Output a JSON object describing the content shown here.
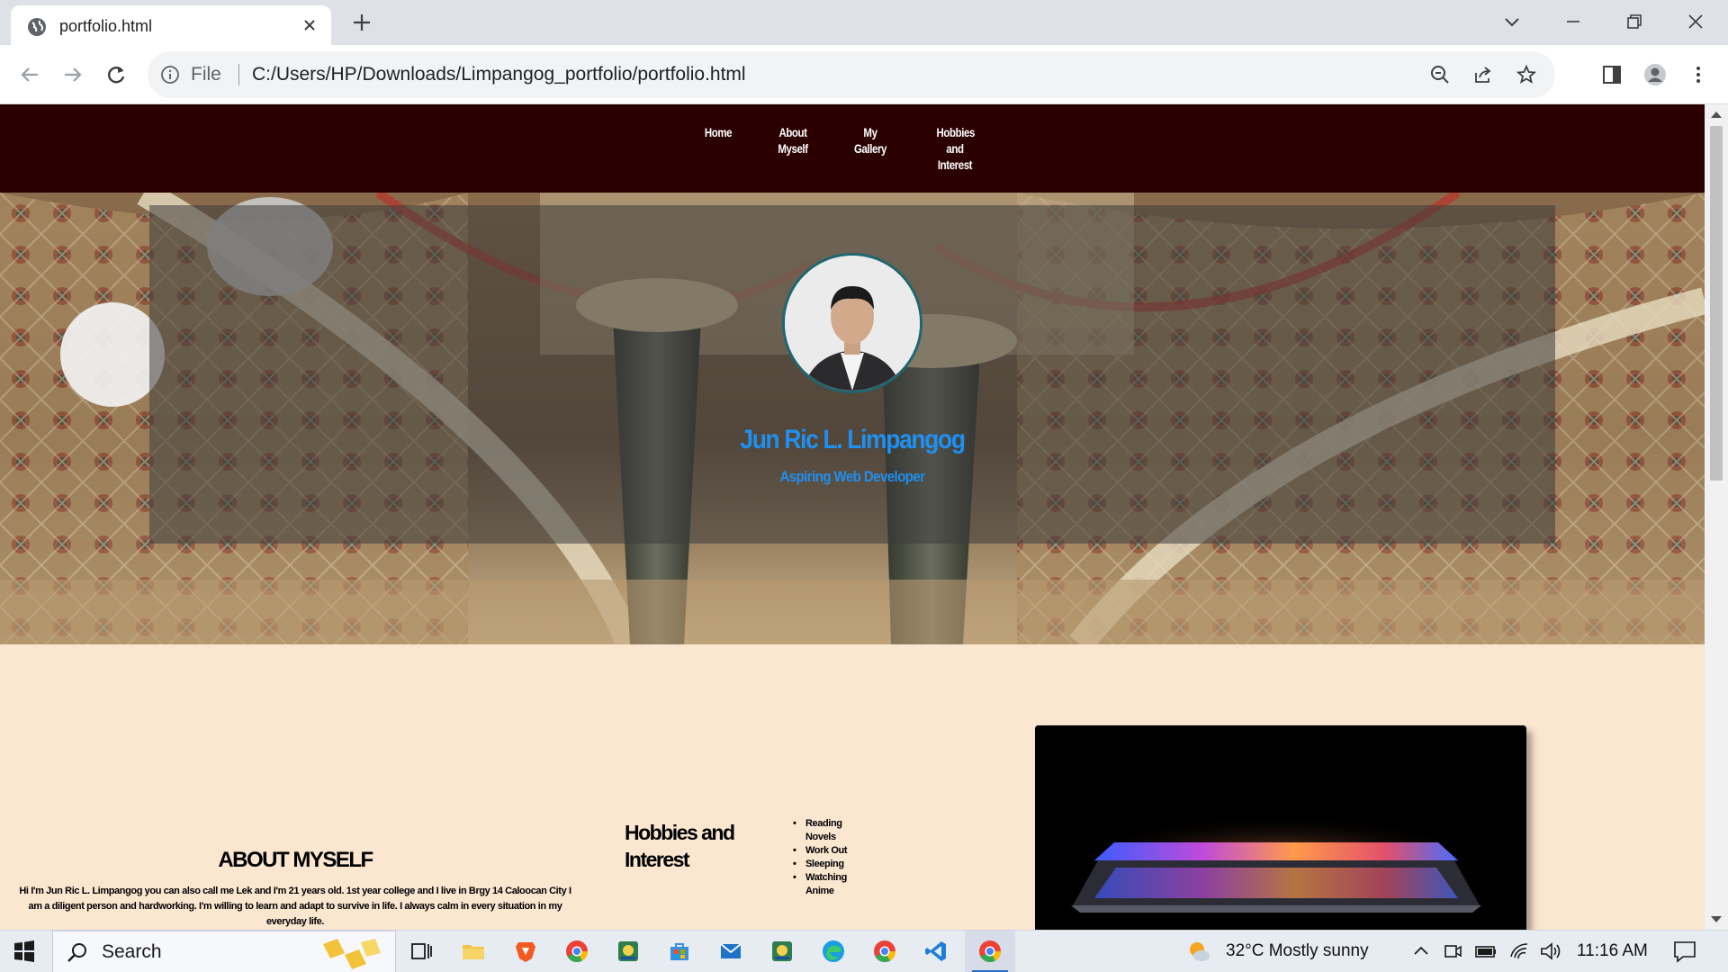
{
  "browser": {
    "tab_title": "portfolio.html",
    "scheme_label": "File",
    "url": "C:/Users/HP/Downloads/Limpangog_portfolio/portfolio.html"
  },
  "site": {
    "nav": [
      {
        "label": "Home"
      },
      {
        "label": "About Myself"
      },
      {
        "label": "My Gallery"
      },
      {
        "label": "Hobbies and Interest"
      }
    ],
    "hero": {
      "name": "Jun Ric L. Limpangog",
      "subtitle": "Aspiring Web Developer"
    },
    "about": {
      "title": "ABOUT MYSELF",
      "text": "Hi I'm Jun Ric L. Limpangog you can also call me Lek and I'm 21 years old. 1st year college and I live in Brgy 14 Caloocan City I am a diligent person and hardworking. I'm willing to learn and adapt to survive in life. I always calm in every situation in my everyday life."
    },
    "hobbies": {
      "title": "Hobbies and Interest",
      "items": [
        "Reading Novels",
        "Work Out",
        "Sleeping",
        "Watching Anime"
      ]
    }
  },
  "taskbar": {
    "search_label": "Search",
    "weather": "32°C  Mostly sunny",
    "time": "11:16 AM"
  },
  "colors": {
    "nav_bg": "#2b0000",
    "page_bg": "#fbe6d0",
    "hero_text": "#1f8ff0"
  }
}
